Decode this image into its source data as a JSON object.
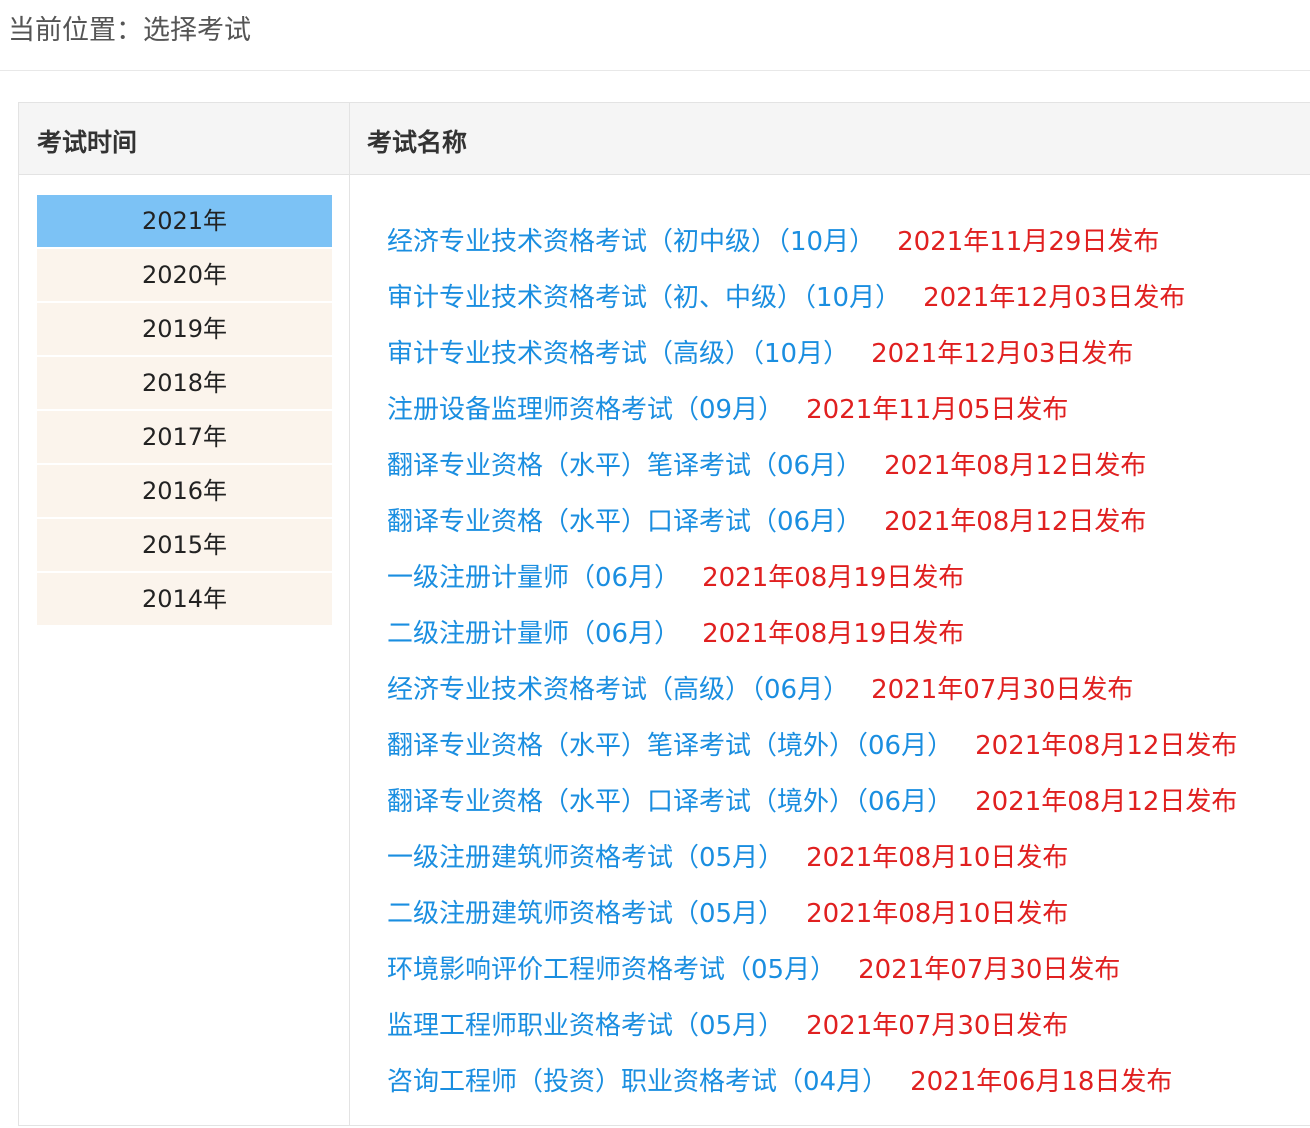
{
  "breadcrumb": {
    "text": "当前位置：选择考试"
  },
  "table": {
    "header_time": "考试时间",
    "header_name": "考试名称"
  },
  "years": [
    {
      "label": "2021年",
      "active": true
    },
    {
      "label": "2020年",
      "active": false
    },
    {
      "label": "2019年",
      "active": false
    },
    {
      "label": "2018年",
      "active": false
    },
    {
      "label": "2017年",
      "active": false
    },
    {
      "label": "2016年",
      "active": false
    },
    {
      "label": "2015年",
      "active": false
    },
    {
      "label": "2014年",
      "active": false
    }
  ],
  "exams": [
    {
      "name": "经济专业技术资格考试（初中级）（10月）",
      "date": "2021年11月29日发布"
    },
    {
      "name": "审计专业技术资格考试（初、中级）（10月）",
      "date": "2021年12月03日发布"
    },
    {
      "name": "审计专业技术资格考试（高级）（10月）",
      "date": "2021年12月03日发布"
    },
    {
      "name": "注册设备监理师资格考试（09月）",
      "date": "2021年11月05日发布"
    },
    {
      "name": "翻译专业资格（水平）笔译考试（06月）",
      "date": "2021年08月12日发布"
    },
    {
      "name": "翻译专业资格（水平）口译考试（06月）",
      "date": "2021年08月12日发布"
    },
    {
      "name": "一级注册计量师（06月）",
      "date": "2021年08月19日发布"
    },
    {
      "name": "二级注册计量师（06月）",
      "date": "2021年08月19日发布"
    },
    {
      "name": "经济专业技术资格考试（高级）（06月）",
      "date": "2021年07月30日发布"
    },
    {
      "name": "翻译专业资格（水平）笔译考试（境外）（06月）",
      "date": "2021年08月12日发布"
    },
    {
      "name": "翻译专业资格（水平）口译考试（境外）（06月）",
      "date": "2021年08月12日发布"
    },
    {
      "name": "一级注册建筑师资格考试（05月）",
      "date": "2021年08月10日发布"
    },
    {
      "name": "二级注册建筑师资格考试（05月）",
      "date": "2021年08月10日发布"
    },
    {
      "name": "环境影响评价工程师资格考试（05月）",
      "date": "2021年07月30日发布"
    },
    {
      "name": "监理工程师职业资格考试（05月）",
      "date": "2021年07月30日发布"
    },
    {
      "name": "咨询工程师（投资）职业资格考试（04月）",
      "date": "2021年06月18日发布"
    }
  ],
  "colors": {
    "link": "#1a8ee0",
    "date": "#e02020",
    "active_year": "#7cc2f5",
    "year_bg": "#fbf4ec"
  }
}
